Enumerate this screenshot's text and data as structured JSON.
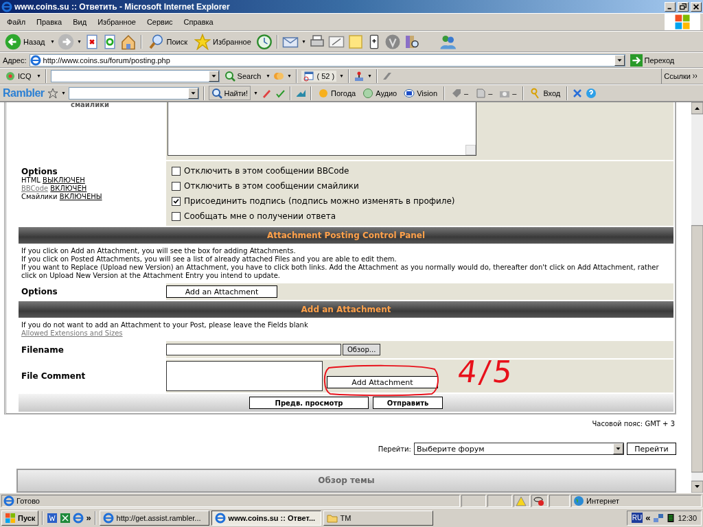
{
  "window": {
    "title": "www.coins.su :: Ответить - Microsoft Internet Explorer"
  },
  "menu": [
    "Файл",
    "Правка",
    "Вид",
    "Избранное",
    "Сервис",
    "Справка"
  ],
  "toolbar": {
    "back": "Назад",
    "search": "Поиск",
    "favorites": "Избранное"
  },
  "address": {
    "label": "Адрес:",
    "value": "http://www.coins.su/forum/posting.php",
    "go": "Переход"
  },
  "icq_bar": {
    "label": "ICQ",
    "search": "Search",
    "count": "( 52 )",
    "links": "Ссылки"
  },
  "rambler_bar": {
    "logo": "Rambler",
    "find": "Найти!",
    "items": [
      "Погода",
      "Аудио",
      "Vision"
    ],
    "dashes": [
      "–",
      "–",
      "–"
    ],
    "login": "Вход"
  },
  "form": {
    "smilies_label": "смайлики",
    "options": {
      "title": "Options",
      "status": [
        {
          "name": "HTML",
          "value": "ВЫКЛЮЧЕН",
          "link": false
        },
        {
          "name": "BBCode",
          "value": "ВКЛЮЧЕН",
          "link": true
        },
        {
          "name": "Смайлики",
          "value": "ВКЛЮЧЕНЫ",
          "link": false
        }
      ],
      "checkboxes": [
        {
          "label": "Отключить в этом сообщении BBCode",
          "checked": false
        },
        {
          "label": "Отключить в этом сообщении смайлики",
          "checked": false
        },
        {
          "label": "Присоединить подпись (подпись можно изменять в профиле)",
          "checked": true
        },
        {
          "label": "Сообщать мне о получении ответа",
          "checked": false
        }
      ]
    },
    "attachment_panel": {
      "title": "Attachment Posting Control Panel",
      "help": [
        "If you click on Add an Attachment, you will see the box for adding Attachments.",
        "If you click on Posted Attachments, you will see a list of already attached Files and you are able to edit them.",
        "If you want to Replace (Upload new Version) an Attachment, you have to click both links. Add the Attachment as you normally would do, thereafter don't click on Add Attachment, rather click on Upload New Version at the Attachment Entry you intend to update."
      ],
      "options_label": "Options",
      "button": "Add an Attachment"
    },
    "add_attachment": {
      "title": "Add an Attachment",
      "note": "If you do not want to add an Attachment to your Post, please leave the Fields blank",
      "link": "Allowed Extensions and Sizes",
      "filename_label": "Filename",
      "browse": "Обзор...",
      "comment_label": "File Comment",
      "button": "Add Attachment"
    },
    "buttons": [
      "Предв. просмотр",
      "Отправить"
    ]
  },
  "annotation": "4/5",
  "timezone": "Часовой пояс: GMT + 3",
  "jump": {
    "label": "Перейти:",
    "value": "Выберите форум",
    "button": "Перейти"
  },
  "topic_review": "Обзор темы",
  "status_bar": {
    "text": "Готово",
    "zone": "Интернет"
  },
  "taskbar": {
    "start": "Пуск",
    "more": "»",
    "tasks": [
      {
        "label": "http://get.assist.rambler...",
        "selected": false,
        "kind": "ie"
      },
      {
        "label": "www.coins.su :: Ответ...",
        "selected": true,
        "kind": "ie"
      },
      {
        "label": "TM",
        "selected": false,
        "kind": "folder"
      }
    ],
    "lang": "RU",
    "collapse": "«",
    "time": "12:30"
  }
}
